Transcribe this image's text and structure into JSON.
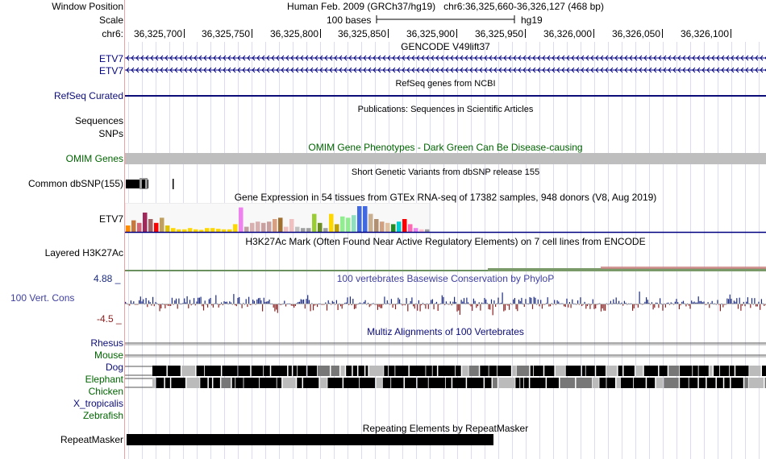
{
  "header": {
    "window_position_label": "Window Position",
    "window_position_text": "Human Feb. 2009 (GRCh37/hg19)   chr6:36,325,660-36,326,127 (468 bp)",
    "scale_label": "Scale",
    "scale_text": "100 bases",
    "scale_assembly": "hg19",
    "chrom_label": "chr6:",
    "ticks": [
      "36,325,700",
      "36,325,750",
      "36,325,800",
      "36,325,850",
      "36,325,900",
      "36,325,950",
      "36,326,000",
      "36,326,050",
      "36,326,100"
    ]
  },
  "tracks": {
    "gencode": {
      "title": "GENCODE V49lift37",
      "items": [
        "ETV7",
        "ETV7"
      ],
      "color": "#000080"
    },
    "refseq": {
      "title": "RefSeq genes from NCBI",
      "label": "RefSeq Curated",
      "color": "#0c0c78"
    },
    "publications": {
      "title": "Publications: Sequences in Scientific Articles",
      "labels": [
        "Sequences",
        "SNPs"
      ]
    },
    "omim": {
      "title": "OMIM Gene Phenotypes - Dark Green Can Be Disease-causing",
      "label": "OMIM Genes",
      "color": "#006400"
    },
    "dbsnp": {
      "title": "Short Genetic Variants from dbSNP release 155",
      "label": "Common dbSNP(155)"
    },
    "gtex": {
      "title": "Gene Expression in 54 tissues from GTEx RNA-seq of 17382 samples, 948 donors (V8, Aug 2019)",
      "label": "ETV7"
    },
    "h3k27ac": {
      "title": "H3K27Ac Mark (Often Found Near Active Regulatory Elements) on 7 cell lines from ENCODE",
      "label": "Layered H3K27Ac"
    },
    "phylop": {
      "title": "100 vertebrates Basewise Conservation by PhyloP",
      "label": "100 Vert. Cons",
      "max_label": "4.88 _",
      "min_label": "-4.5 _",
      "pos_color": "#1a2a80",
      "neg_color": "#8b2020"
    },
    "multiz": {
      "title": "Multiz Alignments of 100 Vertebrates",
      "species": [
        {
          "name": "Rhesus",
          "color": "#0c0c78"
        },
        {
          "name": "Mouse",
          "color": "#006400"
        },
        {
          "name": "Dog",
          "color": "#0c0c78"
        },
        {
          "name": "Elephant",
          "color": "#006400"
        },
        {
          "name": "Chicken",
          "color": "#006400"
        },
        {
          "name": "X_tropicalis",
          "color": "#0c0c78"
        },
        {
          "name": "Zebrafish",
          "color": "#006400"
        }
      ]
    },
    "repeatmasker": {
      "title": "Repeating Elements by RepeatMasker",
      "label": "RepeatMasker"
    }
  },
  "gtex_bars": [
    {
      "v": 0.25,
      "c": "#ff8c00"
    },
    {
      "v": 0.45,
      "c": "#c8783c"
    },
    {
      "v": 0.35,
      "c": "#d26478"
    },
    {
      "v": 0.75,
      "c": "#a0285a"
    },
    {
      "v": 0.5,
      "c": "#a06464"
    },
    {
      "v": 0.35,
      "c": "#ff0000"
    },
    {
      "v": 0.55,
      "c": "#c0a060"
    },
    {
      "v": 0.25,
      "c": "#e0c000"
    },
    {
      "v": 0.15,
      "c": "#ffd700"
    },
    {
      "v": 0.1,
      "c": "#ffd700"
    },
    {
      "v": 0.1,
      "c": "#ffd700"
    },
    {
      "v": 0.15,
      "c": "#ffd700"
    },
    {
      "v": 0.1,
      "c": "#ffd700"
    },
    {
      "v": 0.08,
      "c": "#ffd700"
    },
    {
      "v": 0.15,
      "c": "#ffd700"
    },
    {
      "v": 0.15,
      "c": "#ffd700"
    },
    {
      "v": 0.12,
      "c": "#ffd700"
    },
    {
      "v": 0.1,
      "c": "#ffd700"
    },
    {
      "v": 0.1,
      "c": "#ffd700"
    },
    {
      "v": 0.3,
      "c": "#ffd700"
    },
    {
      "v": 0.95,
      "c": "#ee82ee"
    },
    {
      "v": 0.2,
      "c": "#c0a0a0"
    },
    {
      "v": 0.35,
      "c": "#d8b0b0"
    },
    {
      "v": 0.4,
      "c": "#d8b0b0"
    },
    {
      "v": 0.35,
      "c": "#c8a0a0"
    },
    {
      "v": 0.4,
      "c": "#c8a0a0"
    },
    {
      "v": 0.5,
      "c": "#d8a080"
    },
    {
      "v": 0.55,
      "c": "#a07030"
    },
    {
      "v": 0.2,
      "c": "#f0c0c0"
    },
    {
      "v": 0.5,
      "c": "#f0c0c0"
    },
    {
      "v": 0.2,
      "c": "#c0c0c0"
    },
    {
      "v": 0.15,
      "c": "#a0a0a0"
    },
    {
      "v": 0.15,
      "c": "#a0a0a0"
    },
    {
      "v": 0.7,
      "c": "#9acd32"
    },
    {
      "v": 0.35,
      "c": "#6b8e23"
    },
    {
      "v": 0.15,
      "c": "#a0a0a0"
    },
    {
      "v": 0.7,
      "c": "#ffd700"
    },
    {
      "v": 0.3,
      "c": "#c0a000"
    },
    {
      "v": 0.6,
      "c": "#90ee90"
    },
    {
      "v": 0.55,
      "c": "#90ee90"
    },
    {
      "v": 0.65,
      "c": "#90e0c0"
    },
    {
      "v": 1.0,
      "c": "#4169e1"
    },
    {
      "v": 1.0,
      "c": "#4169e1"
    },
    {
      "v": 0.7,
      "c": "#c8b090"
    },
    {
      "v": 0.5,
      "c": "#b09070"
    },
    {
      "v": 0.4,
      "c": "#d0a080"
    },
    {
      "v": 0.35,
      "c": "#e0c0a0"
    },
    {
      "v": 0.3,
      "c": "#228b22"
    },
    {
      "v": 0.4,
      "c": "#00ced1"
    },
    {
      "v": 0.5,
      "c": "#ff0000"
    },
    {
      "v": 0.3,
      "c": "#ff69b4"
    },
    {
      "v": 0.15,
      "c": "#ee82ee"
    },
    {
      "v": 0.1,
      "c": "#ffc0cb"
    },
    {
      "v": 0.1,
      "c": "#a0a0a0"
    }
  ]
}
